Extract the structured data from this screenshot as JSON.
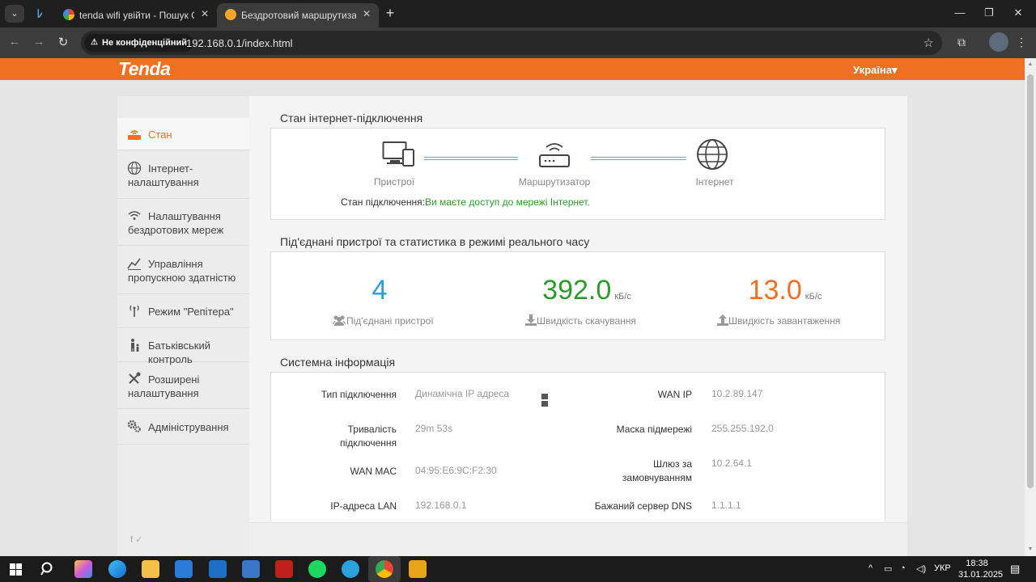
{
  "browser": {
    "tabs": [
      {
        "title": "tenda wifi увійти - Пошук Goo",
        "active": false
      },
      {
        "title": "Бездротовий маршрутизатор",
        "active": true
      }
    ],
    "privacy_label": "Не конфіденційний",
    "url": "192.168.0.1/index.html"
  },
  "header": {
    "logo": "Tenda",
    "language": "Україна▾"
  },
  "sidebar": {
    "items": [
      {
        "label": "Стан",
        "icon": "status-icon",
        "active": true
      },
      {
        "label": "Інтернет-налаштування",
        "icon": "globe-icon"
      },
      {
        "label": "Налаштування бездротових мереж",
        "icon": "wifi-icon"
      },
      {
        "label": "Управління пропускною здатністю",
        "icon": "chart-line-icon"
      },
      {
        "label": "Режим \"Репітера\"",
        "icon": "antenna-icon"
      },
      {
        "label": "Батьківський контроль",
        "icon": "parent-child-icon"
      },
      {
        "label": "Розширені налаштування",
        "icon": "tools-icon"
      },
      {
        "label": "Адміністрування",
        "icon": "gears-icon"
      }
    ],
    "social": "f ✓"
  },
  "internet_status": {
    "title": "Стан інтернет-підключення",
    "nodes": {
      "devices": "Пристрої",
      "router": "Маршрутизатор",
      "internet": "Інтернет"
    },
    "status_label": "Стан підключення:",
    "status_value": "Ви маєте доступ до мережі Інтернет."
  },
  "realtime": {
    "title": "Під'єднані пристрої та статистика в режимі реального часу",
    "devices": {
      "value": "4",
      "label": "Під'єднані пристрої",
      "color": "#2a9fd6"
    },
    "download": {
      "value": "392.0",
      "unit": "кБ/с",
      "label": "Швидкість скачування",
      "color": "#2e9a2e"
    },
    "upload": {
      "value": "13.0",
      "unit": "кБ/с",
      "label": "Швидкість завантаження",
      "color": "#f07023"
    }
  },
  "system_info": {
    "title": "Системна інформація",
    "left": [
      {
        "label": "Тип підключення",
        "value": "Динамічна IP адреса"
      },
      {
        "label": "Тривалість підключення",
        "value": "29m 53s"
      },
      {
        "label": "WAN MAC",
        "value": "04:95:E6:9C:F2:30"
      },
      {
        "label": "IP-адреса LAN",
        "value": "192.168.0.1"
      }
    ],
    "right": [
      {
        "label": "WAN IP",
        "value": "10.2.89.147"
      },
      {
        "label": "Маска підмережі",
        "value": "255.255.192.0"
      },
      {
        "label": "Шлюз за замовчуванням",
        "value": "10.2.64.1"
      },
      {
        "label": "Бажаний сервер DNS",
        "value": "1.1.1.1"
      }
    ]
  },
  "taskbar": {
    "lang": "УКР",
    "time": "18:38",
    "date": "31.01.2025"
  }
}
